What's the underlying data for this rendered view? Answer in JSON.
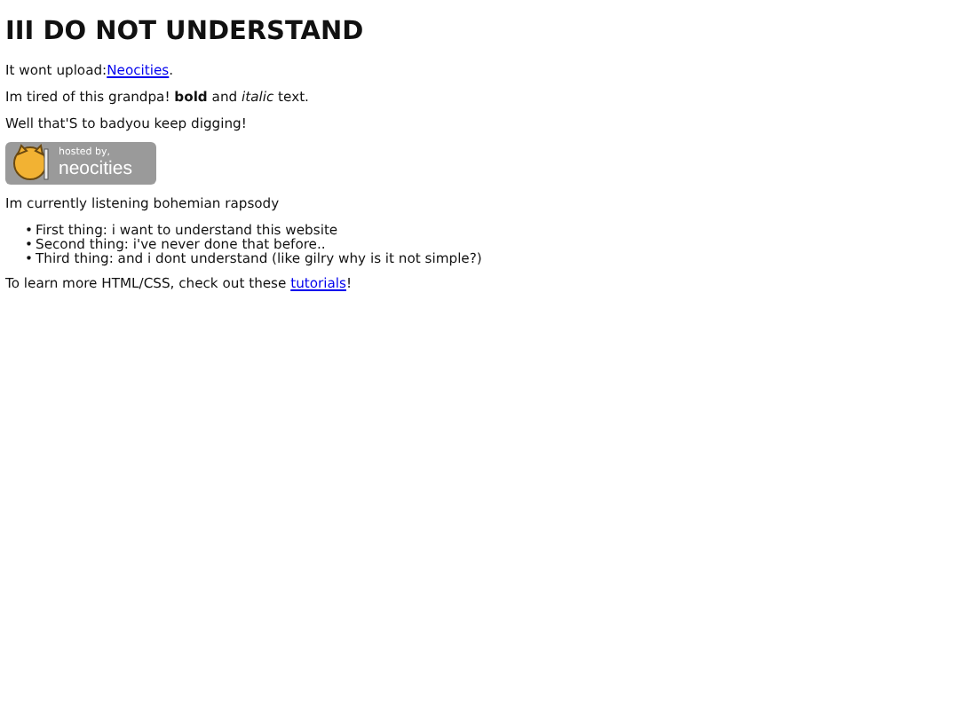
{
  "heading": "III DO NOT UNDERSTAND",
  "upload": {
    "text": "It wont upload:",
    "link": "Neocities",
    "after": "."
  },
  "tired": "Im tired of this grandpa! **bold** and *italic* text.",
  "digging": "Well that'S to badyou keep digging!",
  "badge": {
    "small": "hosted by,",
    "big": "neocities"
  },
  "listening": "Im currently listening bohemian rapsody",
  "things": [
    {
      "bullet": "•",
      "text": "First thing: i want to understand this website"
    },
    {
      "bullet": "•",
      "text": "Second thing: i've never done that before.."
    },
    {
      "bullet": "•",
      "text": "Third thing: and i dont understand (like gilry why is it not simple?)"
    }
  ],
  "learn": {
    "text": "To learn more HTML/CSS, check out these ",
    "link": "tutorials",
    "after": "!"
  }
}
